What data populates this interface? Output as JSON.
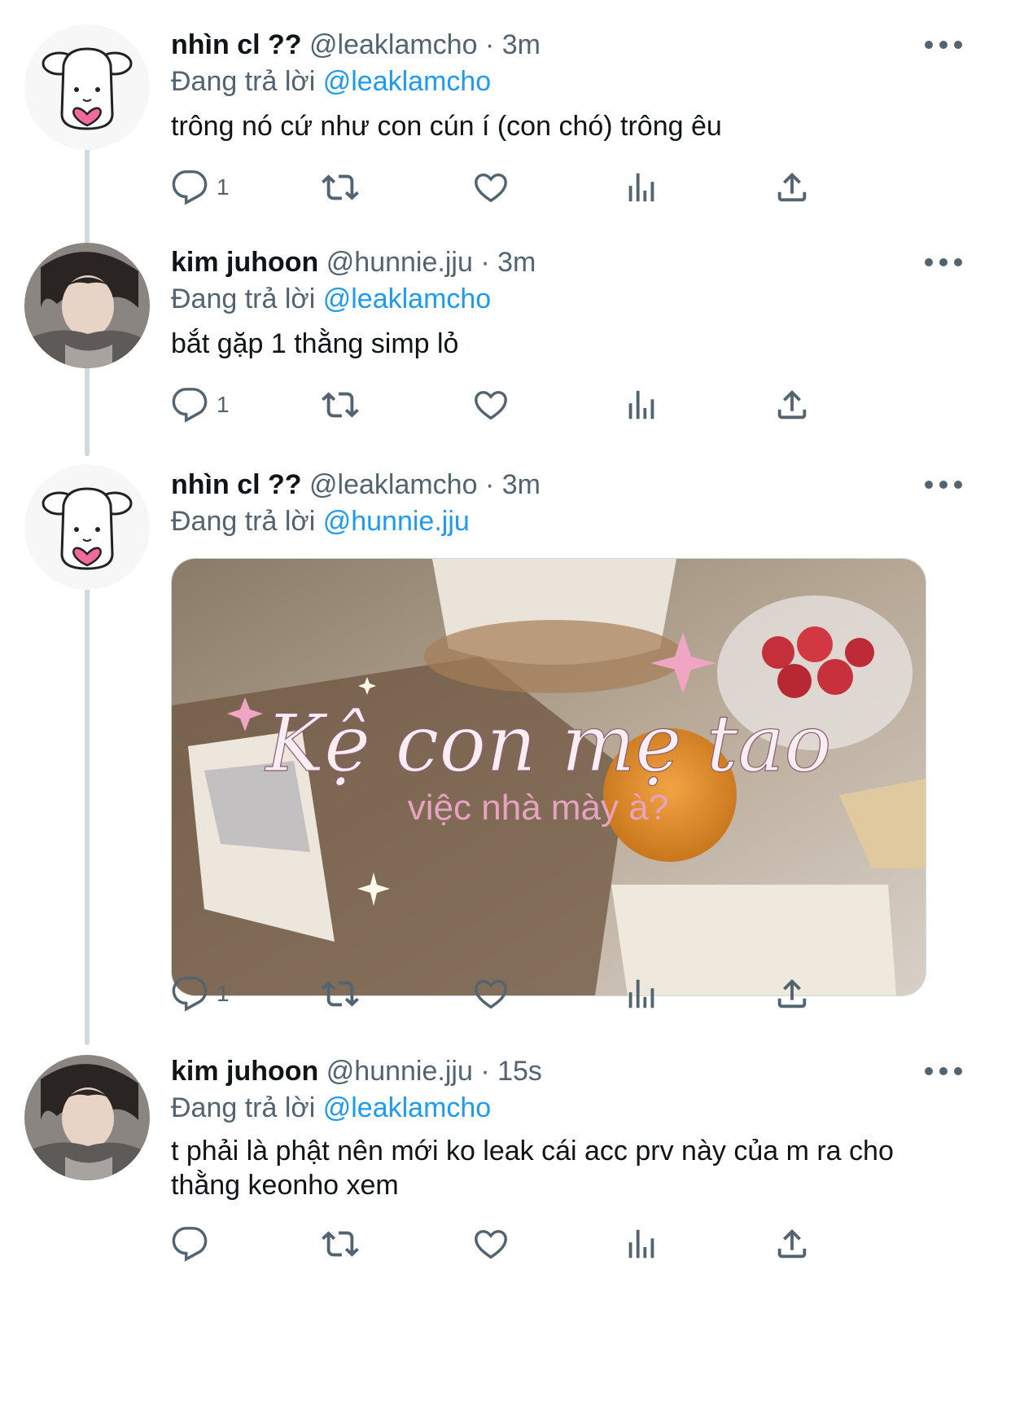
{
  "tweets": [
    {
      "name": "nhìn cl ??",
      "handle": "@leaklamcho",
      "dot": "·",
      "time": "3m",
      "reply_prefix": "Đang trả lời",
      "reply_to": "@leaklamcho",
      "text": "trông nó cứ như con cún í (con chó) trông êu",
      "reply_count": "1",
      "avatar": "puppy-avatar"
    },
    {
      "name": "kim juhoon",
      "handle": "@hunnie.jju",
      "dot": "·",
      "time": "3m",
      "reply_prefix": "Đang trả lời",
      "reply_to": "@leaklamcho",
      "text": "bắt gặp 1 thằng simp lỏ",
      "reply_count": "1",
      "avatar": "photo-avatar"
    },
    {
      "name": "nhìn cl ??",
      "handle": "@leaklamcho",
      "dot": "·",
      "time": "3m",
      "reply_prefix": "Đang trả lời",
      "reply_to": "@hunnie.jju",
      "text": "",
      "reply_count": "1",
      "avatar": "puppy-avatar",
      "media": {
        "title": "Kệ con mẹ tao",
        "subtitle": "việc nhà mày à?"
      }
    },
    {
      "name": "kim juhoon",
      "handle": "@hunnie.jju",
      "dot": "·",
      "time": "15s",
      "reply_prefix": "Đang trả lời",
      "reply_to": "@leaklamcho",
      "text": "t phải là phật nên mới ko leak cái acc prv này của m ra cho thằng keonho xem",
      "reply_count": "",
      "avatar": "photo-avatar"
    }
  ],
  "icons": {
    "reply": "reply-icon",
    "retweet": "retweet-icon",
    "like": "heart-icon",
    "views": "bar-chart-icon",
    "share": "share-icon",
    "more": "more-icon"
  },
  "colors": {
    "mention": "#1d9bf0",
    "secondary_text": "#536471",
    "thread_line": "#cfd9de",
    "heart_pink": "#f06a9a"
  }
}
